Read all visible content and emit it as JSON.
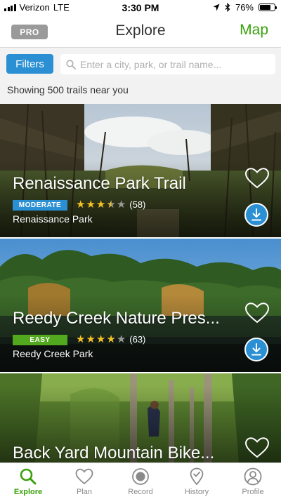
{
  "status_bar": {
    "carrier": "Verizon",
    "network": "LTE",
    "time": "3:30 PM",
    "battery": "76%",
    "battery_level": 0.76
  },
  "header": {
    "pro_label": "PRO",
    "title": "Explore",
    "map_label": "Map"
  },
  "search": {
    "filters_label": "Filters",
    "placeholder": "Enter a city, park, or trail name...",
    "value": "",
    "result_summary": "Showing 500 trails near you"
  },
  "trails": [
    {
      "name": "Renaissance Park Trail",
      "difficulty": "MODERATE",
      "difficulty_color": "#2a8fd3",
      "rating": 3.5,
      "reviews": "(58)",
      "park": "Renaissance Park"
    },
    {
      "name": "Reedy Creek Nature Pres...",
      "difficulty": "EASY",
      "difficulty_color": "#52a81e",
      "rating": 4,
      "reviews": "(63)",
      "park": "Reedy Creek Park"
    },
    {
      "name": "Back Yard Mountain Bike..."
    }
  ],
  "colors": {
    "accent_green": "#3aa10c",
    "accent_blue": "#2a8fd3"
  },
  "tabs": [
    {
      "label": "Explore",
      "icon": "search-icon",
      "active": true
    },
    {
      "label": "Plan",
      "icon": "heart-icon",
      "active": false
    },
    {
      "label": "Record",
      "icon": "record-icon",
      "active": false
    },
    {
      "label": "History",
      "icon": "map-pin-icon",
      "active": false
    },
    {
      "label": "Profile",
      "icon": "profile-icon",
      "active": false
    }
  ]
}
